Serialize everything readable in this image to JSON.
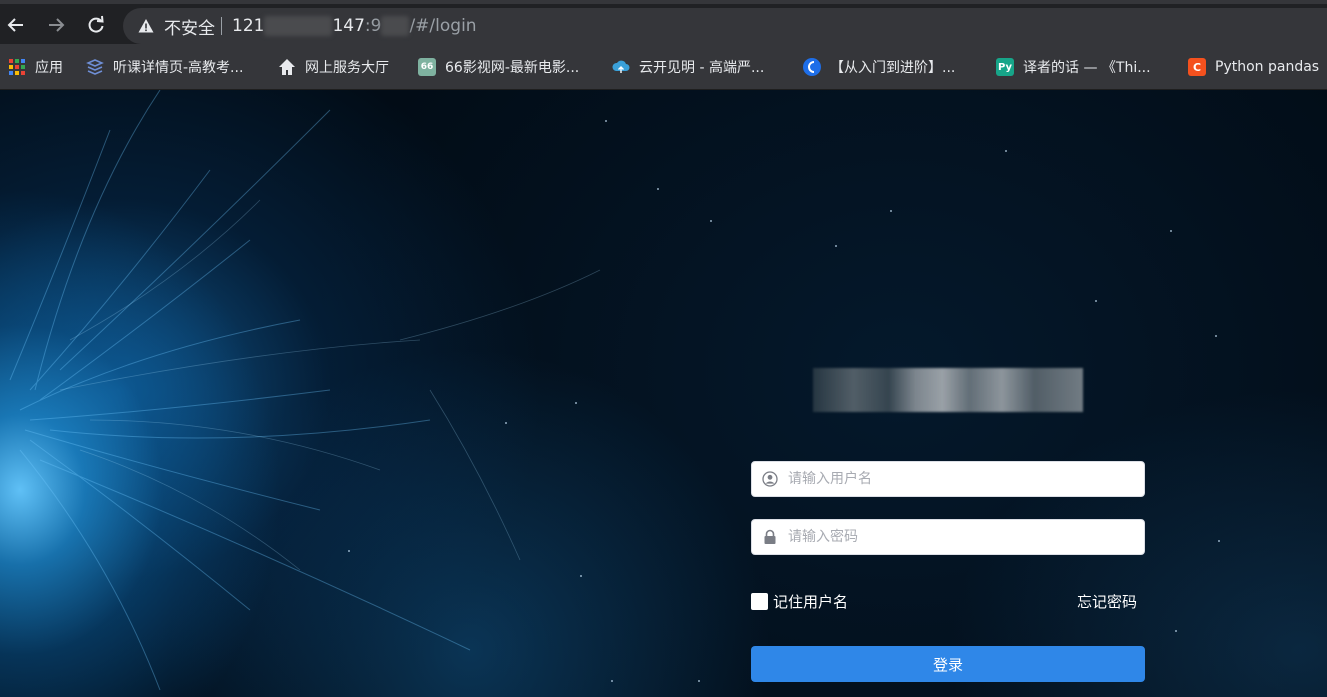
{
  "browser": {
    "security_label": "不安全",
    "url_host_prefix": "121",
    "url_host_mid": "147",
    "url_port_prefix": ":9",
    "url_path": "/#/login"
  },
  "bookmarks": [
    {
      "label": "应用",
      "icon": "apps-grid-icon"
    },
    {
      "label": "听课详情页-高教考...",
      "icon": "layers-icon"
    },
    {
      "label": "网上服务大厅",
      "icon": "home-icon"
    },
    {
      "label": "66影视网-最新电影...",
      "icon": "film-icon"
    },
    {
      "label": "云开见明 - 高端严...",
      "icon": "cloud-icon"
    },
    {
      "label": "【从入门到进阶】...",
      "icon": "circle-icon"
    },
    {
      "label": "译者的话 — 《Thi...",
      "icon": "python-icon"
    },
    {
      "label": "Python pandas",
      "icon": "c-letter-icon"
    }
  ],
  "login": {
    "username_placeholder": "请输入用户名",
    "password_placeholder": "请输入密码",
    "remember_label": "记住用户名",
    "forgot_label": "忘记密码",
    "submit_label": "登录"
  },
  "colors": {
    "primary_button": "#2f87e8",
    "chrome_dark": "#202124",
    "chrome_bar": "#35363a"
  }
}
